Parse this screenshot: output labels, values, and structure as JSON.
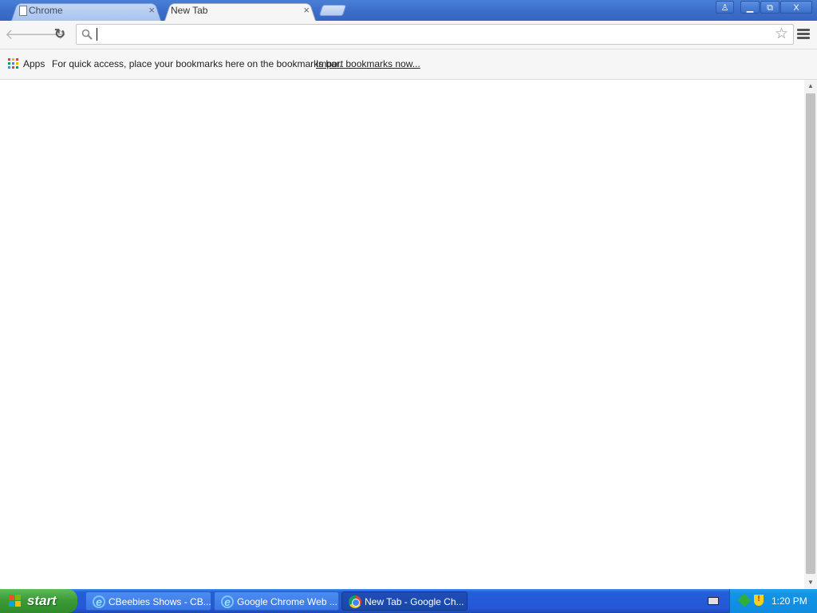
{
  "tabs": [
    {
      "label": "Chrome",
      "close": "×"
    },
    {
      "label": "New Tab",
      "close": "×"
    }
  ],
  "window_controls": {
    "user": "♙",
    "minimize": "▁",
    "maximize": "⧉",
    "close": "X"
  },
  "toolbar": {
    "back": "🡐",
    "forward": "🡒",
    "reload": "↻",
    "star": "☆"
  },
  "omnibox": {
    "value": "",
    "placeholder": ""
  },
  "bookmarks_bar": {
    "apps_label": "Apps",
    "message": "For quick access, place your bookmarks here on the bookmarks bar.",
    "import_link": "Import bookmarks now..."
  },
  "scrollbar": {
    "up": "▲",
    "down": "▼"
  },
  "taskbar": {
    "start_label": "start",
    "tasks": [
      {
        "label": "CBeebies Shows - CB..."
      },
      {
        "label": "Google Chrome Web ..."
      },
      {
        "label": "New Tab - Google Ch..."
      }
    ],
    "clock": "1:20 PM"
  },
  "colors": {
    "titlebar": "#3a6cc8",
    "taskbar": "#2557d6",
    "start_green": "#3c9b37",
    "tray": "#1394e6"
  },
  "icons": [
    "document-icon",
    "search-icon",
    "star-icon",
    "menu-icon",
    "apps-grid-icon",
    "ie-icon",
    "chrome-icon",
    "windows-flag-icon",
    "keyboard-icon",
    "network-icon",
    "security-shield-icon"
  ]
}
